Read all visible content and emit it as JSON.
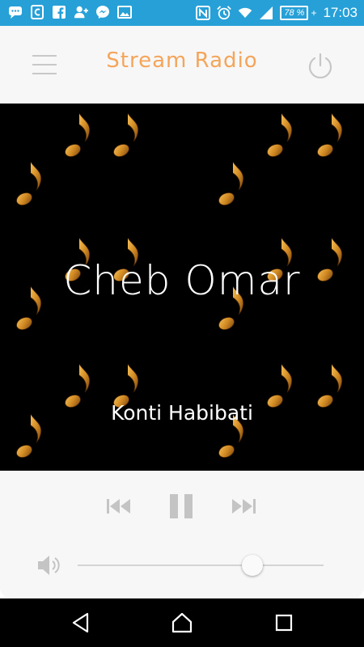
{
  "status_bar": {
    "icons_left": [
      "chat-icon",
      "c-badge-icon",
      "facebook-icon",
      "add-contact-icon",
      "messenger-icon",
      "image-icon"
    ],
    "icons_right": [
      "nfc-icon",
      "alarm-icon",
      "wifi-icon",
      "signal-icon"
    ],
    "battery_percent": "78 %",
    "battery_charging_symbol": "+",
    "time": "17:03"
  },
  "header": {
    "title": "Stream Radio",
    "menu_icon": "hamburger-menu-icon",
    "power_icon": "power-icon"
  },
  "now_playing": {
    "artist": "Cheb Omar",
    "song": "Konti Habibati"
  },
  "player": {
    "prev_icon": "skip-previous-icon",
    "pause_icon": "pause-icon",
    "next_icon": "skip-next-icon",
    "volume_icon": "volume-icon",
    "volume_level": 0.71
  },
  "nav_bar": {
    "back_icon": "back-icon",
    "home_icon": "home-icon",
    "recents_icon": "recents-icon"
  },
  "colors": {
    "status_bar": "#27a0d8",
    "title": "#f4a55a",
    "artwork_background": "#000000",
    "note_gold": "#d28a22"
  }
}
